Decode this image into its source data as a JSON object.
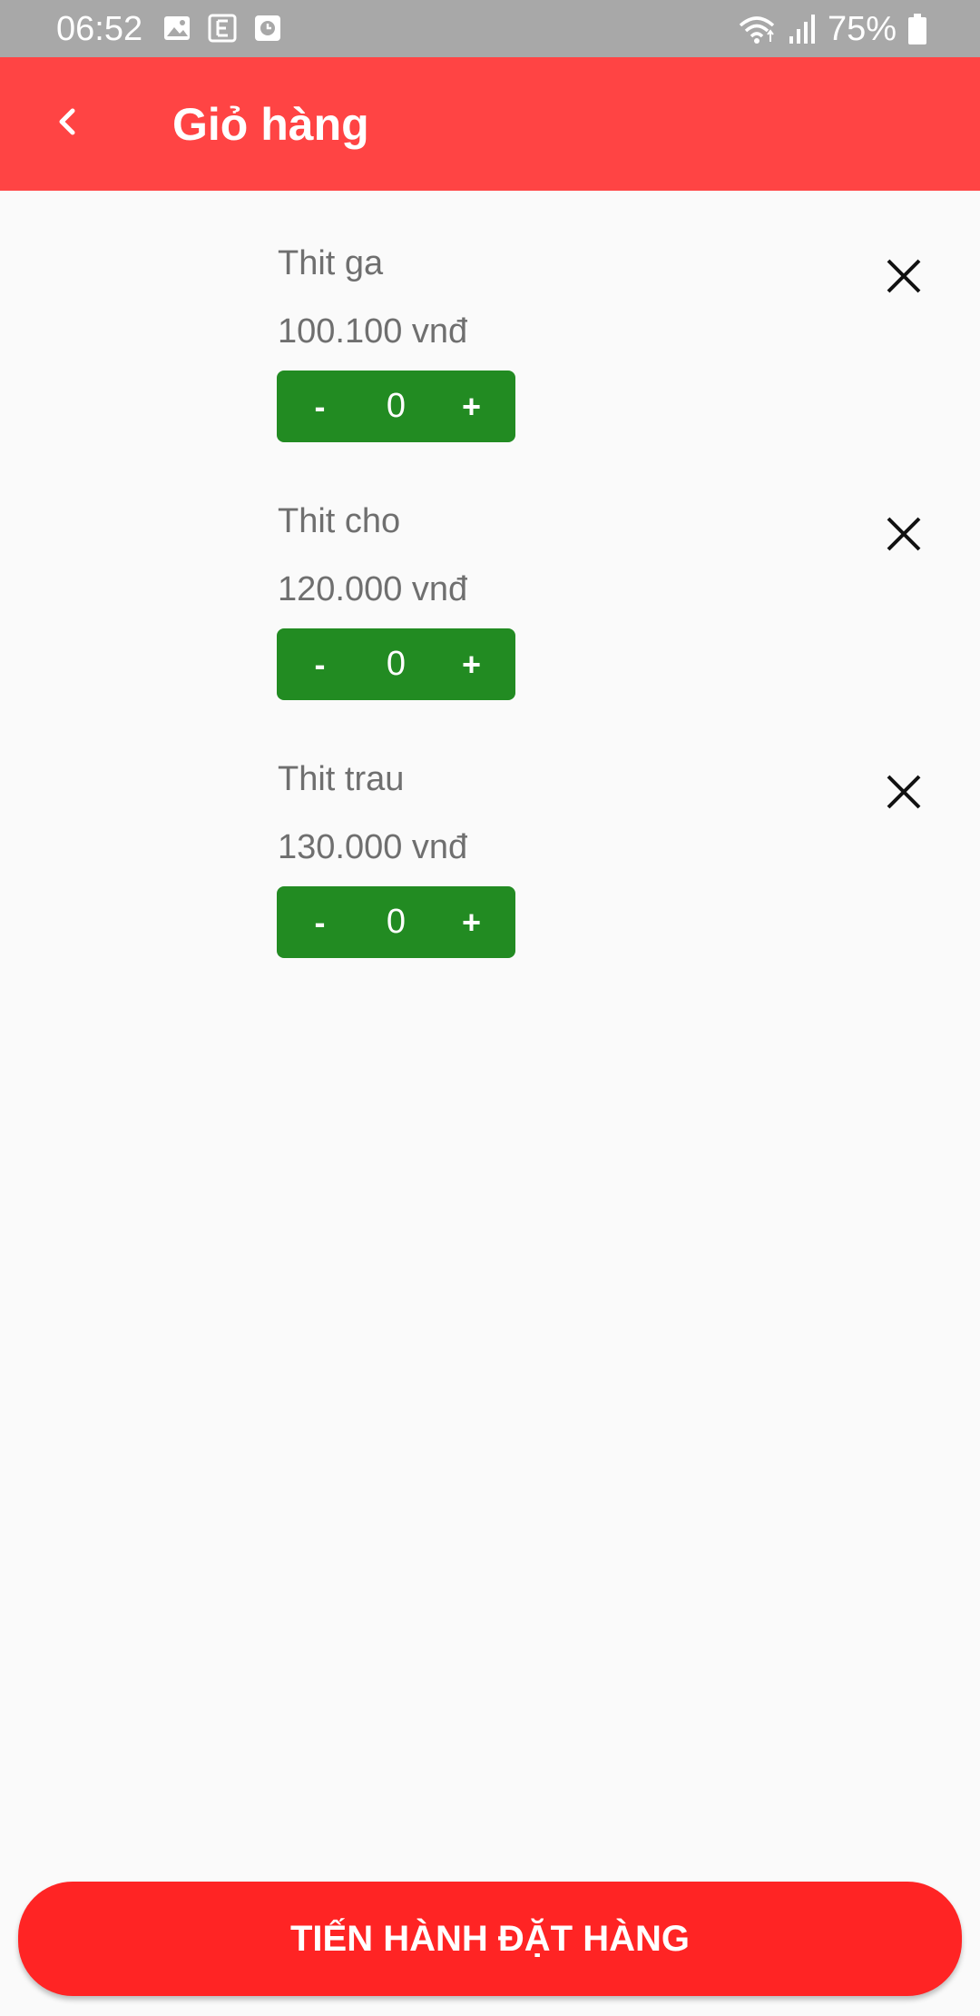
{
  "status_bar": {
    "time": "06:52",
    "left_icons": [
      "gallery-icon",
      "e-icon",
      "clock-icon"
    ],
    "right_icons": [
      "wifi-icon",
      "signal-icon",
      "battery-icon"
    ],
    "battery": "75%"
  },
  "app_bar": {
    "title": "Giỏ hàng",
    "back_icon": "chevron-left-icon",
    "background": "#ff4444"
  },
  "cart": {
    "items": [
      {
        "name": "Thit ga",
        "price": "100.100 vnđ",
        "quantity": "0",
        "minus": "-",
        "plus": "+"
      },
      {
        "name": "Thit cho",
        "price": "120.000 vnđ",
        "quantity": "0",
        "minus": "-",
        "plus": "+"
      },
      {
        "name": "Thit trau",
        "price": "130.000 vnđ",
        "quantity": "0",
        "minus": "-",
        "plus": "+"
      }
    ],
    "stepper_color": "#228b22",
    "remove_icon": "close-icon"
  },
  "checkout": {
    "label": "TIẾN HÀNH ĐẶT HÀNG",
    "color": "#ff2424"
  }
}
